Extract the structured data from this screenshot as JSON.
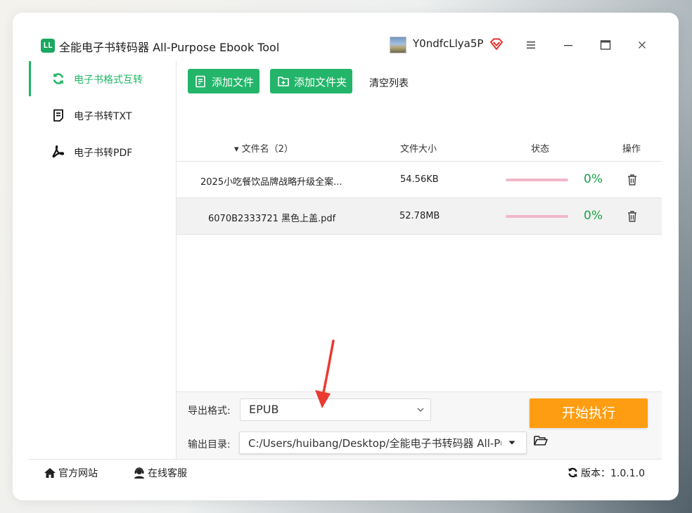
{
  "app": {
    "logo_text": "LL",
    "title": "全能电子书转码器 All-Purpose Ebook Tool",
    "username": "Y0ndfcLlya5P"
  },
  "sidebar": {
    "items": [
      {
        "label": "电子书格式互转",
        "icon": "refresh-icon",
        "active": true
      },
      {
        "label": "电子书转TXT",
        "icon": "document-icon",
        "active": false
      },
      {
        "label": "电子书转PDF",
        "icon": "pdf-icon",
        "active": false
      }
    ]
  },
  "toolbar": {
    "add_file": "添加文件",
    "add_folder": "添加文件夹",
    "clear_list": "清空列表"
  },
  "table": {
    "headers": {
      "name": "▾ 文件名（2）",
      "size": "文件大小",
      "status": "状态",
      "action": "操作"
    },
    "rows": [
      {
        "name": "2025小吃餐饮品牌战略升级全案...",
        "size": "54.56KB",
        "progress": 0,
        "percent": "0%"
      },
      {
        "name": "6070B2333721 黑色上盖.pdf",
        "size": "52.78MB",
        "progress": 0,
        "percent": "0%"
      }
    ]
  },
  "settings": {
    "format_label": "导出格式:",
    "format_value": "EPUB",
    "dir_label": "输出目录:",
    "dir_value": "C:/Users/huibang/Desktop/全能电子书转码器 All-Pu",
    "start_label": "开始执行"
  },
  "footer": {
    "website": "官方网站",
    "support": "在线客服",
    "version": "版本：1.0.1.0"
  },
  "colors": {
    "accent_green": "#23b56a",
    "start_orange": "#ff9d12",
    "progress_track": "#f2b7c8",
    "percent_green": "#1aa346",
    "annotation_red": "#ea3a32"
  }
}
